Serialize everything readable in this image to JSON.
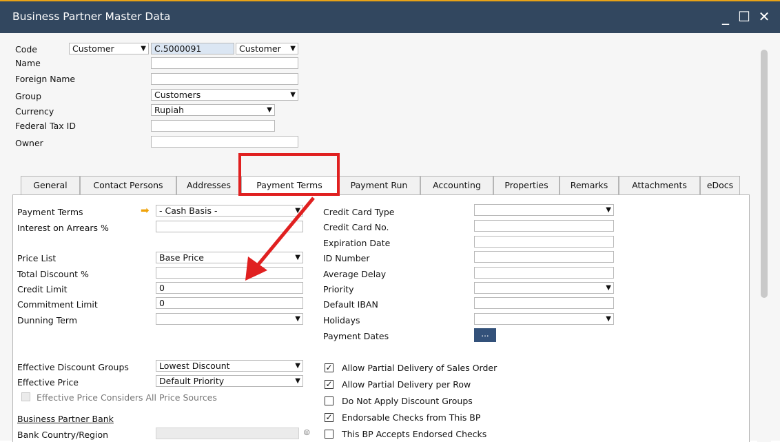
{
  "window": {
    "title": "Business Partner Master Data",
    "minimize": "_",
    "maximize": "☐",
    "close": "✕"
  },
  "header": {
    "code_label": "Code",
    "code_type": "Customer",
    "code_value": "C.5000091",
    "code_series": "Customer",
    "name_label": "Name",
    "name_value": "",
    "foreign_name_label": "Foreign Name",
    "foreign_name_value": "",
    "group_label": "Group",
    "group_value": "Customers",
    "currency_label": "Currency",
    "currency_value": "Rupiah",
    "federal_tax_label": "Federal Tax ID",
    "federal_tax_value": "",
    "owner_label": "Owner",
    "owner_value": ""
  },
  "tabs": [
    {
      "label": "General"
    },
    {
      "label": "Contact Persons"
    },
    {
      "label": "Addresses"
    },
    {
      "label": "Payment Terms",
      "active": true
    },
    {
      "label": "Payment Run"
    },
    {
      "label": "Accounting"
    },
    {
      "label": "Properties"
    },
    {
      "label": "Remarks"
    },
    {
      "label": "Attachments"
    },
    {
      "label": "eDocs"
    }
  ],
  "left": {
    "payment_terms_label": "Payment Terms",
    "payment_terms_value": "- Cash Basis -",
    "interest_label": "Interest on Arrears %",
    "interest_value": "",
    "price_list_label": "Price List",
    "price_list_value": "Base Price",
    "total_discount_label": "Total Discount %",
    "total_discount_value": "",
    "credit_limit_label": "Credit Limit",
    "credit_limit_value": "0",
    "commitment_limit_label": "Commitment Limit",
    "commitment_limit_value": "0",
    "dunning_term_label": "Dunning Term",
    "dunning_term_value": "",
    "eff_discount_groups_label": "Effective Discount Groups",
    "eff_discount_groups_value": "Lowest Discount",
    "eff_price_label": "Effective Price",
    "eff_price_value": "Default Priority",
    "eff_price_all_sources_label": "Effective Price Considers All Price Sources",
    "bp_bank_label": "Business Partner Bank",
    "bank_country_label": "Bank Country/Region",
    "bank_country_value": ""
  },
  "right": {
    "cc_type_label": "Credit Card Type",
    "cc_no_label": "Credit Card  No.",
    "expiration_label": "Expiration Date",
    "id_number_label": "ID Number",
    "avg_delay_label": "Average Delay",
    "priority_label": "Priority",
    "default_iban_label": "Default IBAN",
    "holidays_label": "Holidays",
    "payment_dates_label": "Payment Dates",
    "payment_dates_button": "..."
  },
  "checks": [
    {
      "label": "Allow Partial Delivery of Sales Order",
      "checked": true,
      "mark": "✓"
    },
    {
      "label": "Allow Partial Delivery per Row",
      "checked": true,
      "mark": "✓"
    },
    {
      "label": "Do Not Apply Discount Groups",
      "checked": false,
      "mark": ""
    },
    {
      "label": "Endorsable Checks from This BP",
      "checked": true,
      "mark": "✓"
    },
    {
      "label": "This BP Accepts Endorsed Checks",
      "checked": false,
      "mark": ""
    }
  ],
  "colors": {
    "titlebar": "#32475f",
    "annotation": "#e02020",
    "accent_arrow": "#f0a30a"
  }
}
